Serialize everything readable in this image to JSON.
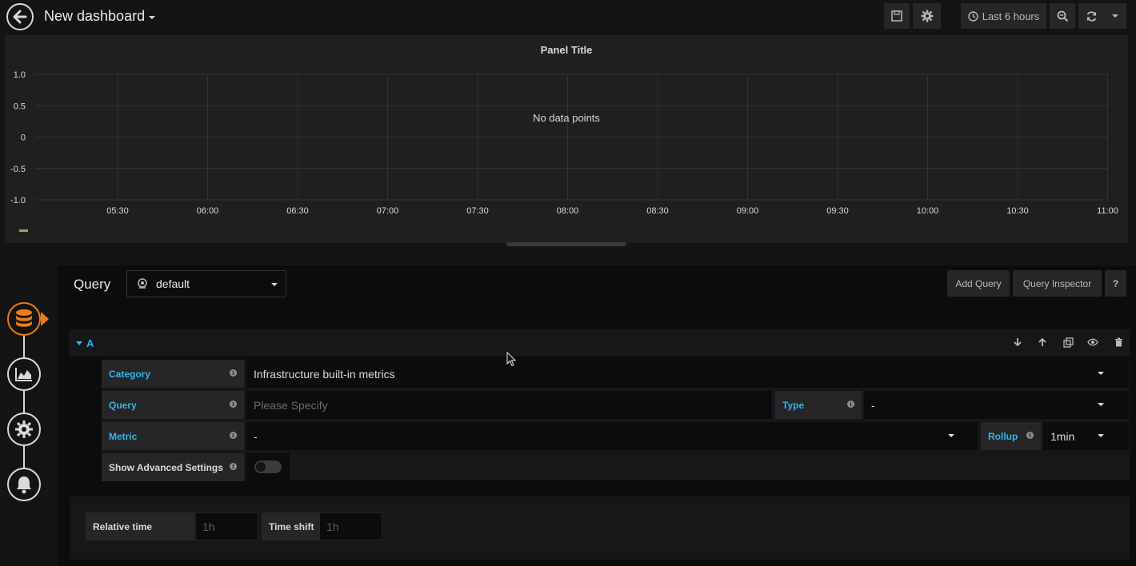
{
  "header": {
    "title": "New dashboard",
    "time_range": "Last 6 hours"
  },
  "panel": {
    "title": "Panel Title",
    "empty_message": "No data points"
  },
  "chart_data": {
    "type": "line",
    "title": "Panel Title",
    "y_ticks": [
      "1.0",
      "0.5",
      "0",
      "-0.5",
      "-1.0"
    ],
    "x_ticks": [
      "05:30",
      "06:00",
      "06:30",
      "07:00",
      "07:30",
      "08:00",
      "08:30",
      "09:00",
      "09:30",
      "10:00",
      "10:30",
      "11:00"
    ],
    "ylim": [
      -1.0,
      1.0
    ],
    "series": [],
    "grid": true,
    "annotations": [
      "No data points"
    ]
  },
  "editor": {
    "query_label": "Query",
    "datasource": "default",
    "add_query_label": "Add Query",
    "query_inspector_label": "Query Inspector",
    "help_label": "?",
    "row_label": "A",
    "fields": {
      "category_label": "Category",
      "category_value": "Infrastructure built-in metrics",
      "query_label": "Query",
      "query_placeholder": "Please Specify",
      "type_label": "Type",
      "type_value": "-",
      "metric_label": "Metric",
      "metric_value": "-",
      "rollup_label": "Rollup",
      "rollup_value": "1min",
      "advanced_label": "Show Advanced Settings",
      "info": "i"
    },
    "time": {
      "relative_label": "Relative time",
      "relative_placeholder": "1h",
      "shift_label": "Time shift",
      "shift_placeholder": "1h"
    }
  },
  "colors": {
    "accent": "#eb7b18",
    "label_blue": "#33b5e5",
    "series_green": "#7eb26d"
  }
}
